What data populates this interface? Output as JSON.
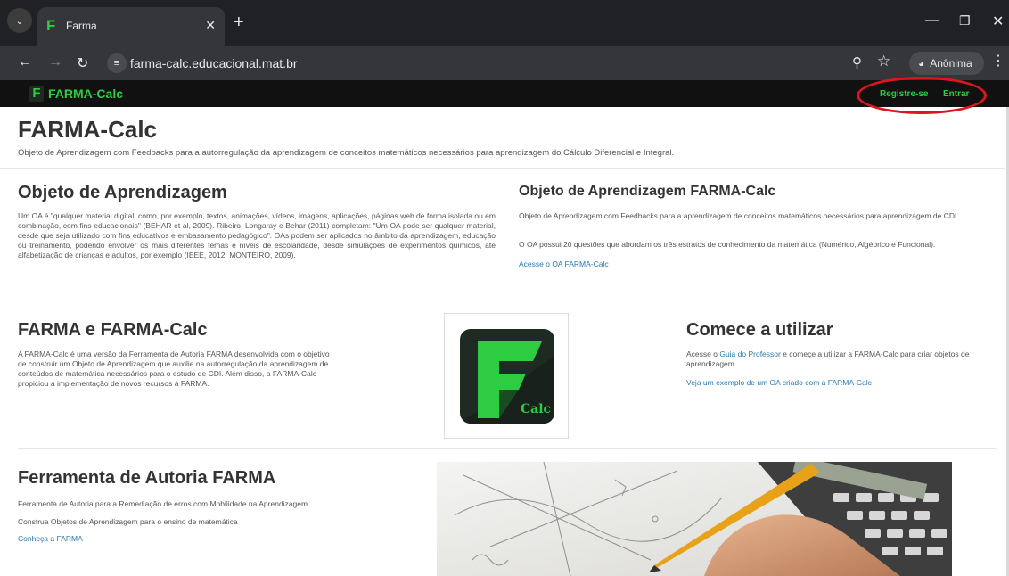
{
  "browser": {
    "tab_title": "Farma",
    "tab_favicon_letter": "F",
    "url": "farma-calc.educacional.mat.br",
    "incognito_label": "Anônima"
  },
  "navbar": {
    "brand": "FARMA-Calc",
    "register": "Registre-se",
    "login": "Entrar"
  },
  "hero": {
    "title": "FARMA-Calc",
    "subtitle": "Objeto de Aprendizagem com Feedbacks para a autorregulação da aprendizagem de conceitos matemáticos necessários para aprendizagem do Cálculo Diferencial e Integral."
  },
  "section_oa": {
    "title": "Objeto de Aprendizagem",
    "text": "Um OA é \"qualquer material digital, como, por exemplo, textos, animações, vídeos, imagens, aplicações, páginas web de forma isolada ou em combinação, com fins educacionais\" (BEHAR et al, 2009). Ribeiro, Longaray e Behar (2011) completam: \"Um OA pode ser qualquer material, desde que seja utilizado com fins educativos e embasamento pedagógico\". OAs podem ser aplicados no âmbito da aprendizagem, educação ou treinamento, podendo envolver os mais diferentes temas e níveis de escolaridade, desde simulações de experimentos químicos, até alfabetização de crianças e adultos, por exemplo (IEEE, 2012; MONTEIRO, 2009)."
  },
  "section_oa_farma": {
    "title": "Objeto de Aprendizagem FARMA-Calc",
    "text1": "Objeto de Aprendizagem com Feedbacks para a aprendizagem de conceitos matemáticos necessários para aprendizagem de CDI.",
    "text2": "O OA possui 20 questões que abordam os três estratos de conhecimento da matemática (Numérico, Algébrico e Funcional).",
    "link": "Acesse o OA FARMA-Calc"
  },
  "section_farma_calc": {
    "title": "FARMA e FARMA-Calc",
    "text": "A FARMA-Calc é uma versão da Ferramenta de Autoria FARMA desenvolvida com o objetivo de construir um Objeto de Aprendizagem que auxilie na autorregulação da aprendizagem de conteúdos de matemática necessários para o estudo de CDI. Além disso, a FARMA-Calc propiciou a implementação de novos recursos à FARMA."
  },
  "logo": {
    "letter": "F",
    "caption": "Calc"
  },
  "section_start": {
    "title": "Comece a utilizar",
    "text_before": "Acesse o ",
    "guide_link": "Guia do Professor",
    "text_after": " e começe a utilizar a FARMA-Calc para criar objetos de aprendizagem.",
    "example_link": "Veja um exemplo de um OA criado com a FARMA-Calc"
  },
  "section_tool": {
    "title": "Ferramenta de Autoria FARMA",
    "text1": "Ferramenta de Autoria para a Remediação de erros com Mobilidade na Aprendizagem.",
    "text2": "Construa Objetos de Aprendizagem para o ensino de matemática",
    "link": "Conheça a FARMA"
  },
  "colors": {
    "brand_green": "#2ecc40",
    "link_blue": "#2a7ab0",
    "annotation_red": "#e0141c",
    "navbar_bg": "#111111"
  }
}
